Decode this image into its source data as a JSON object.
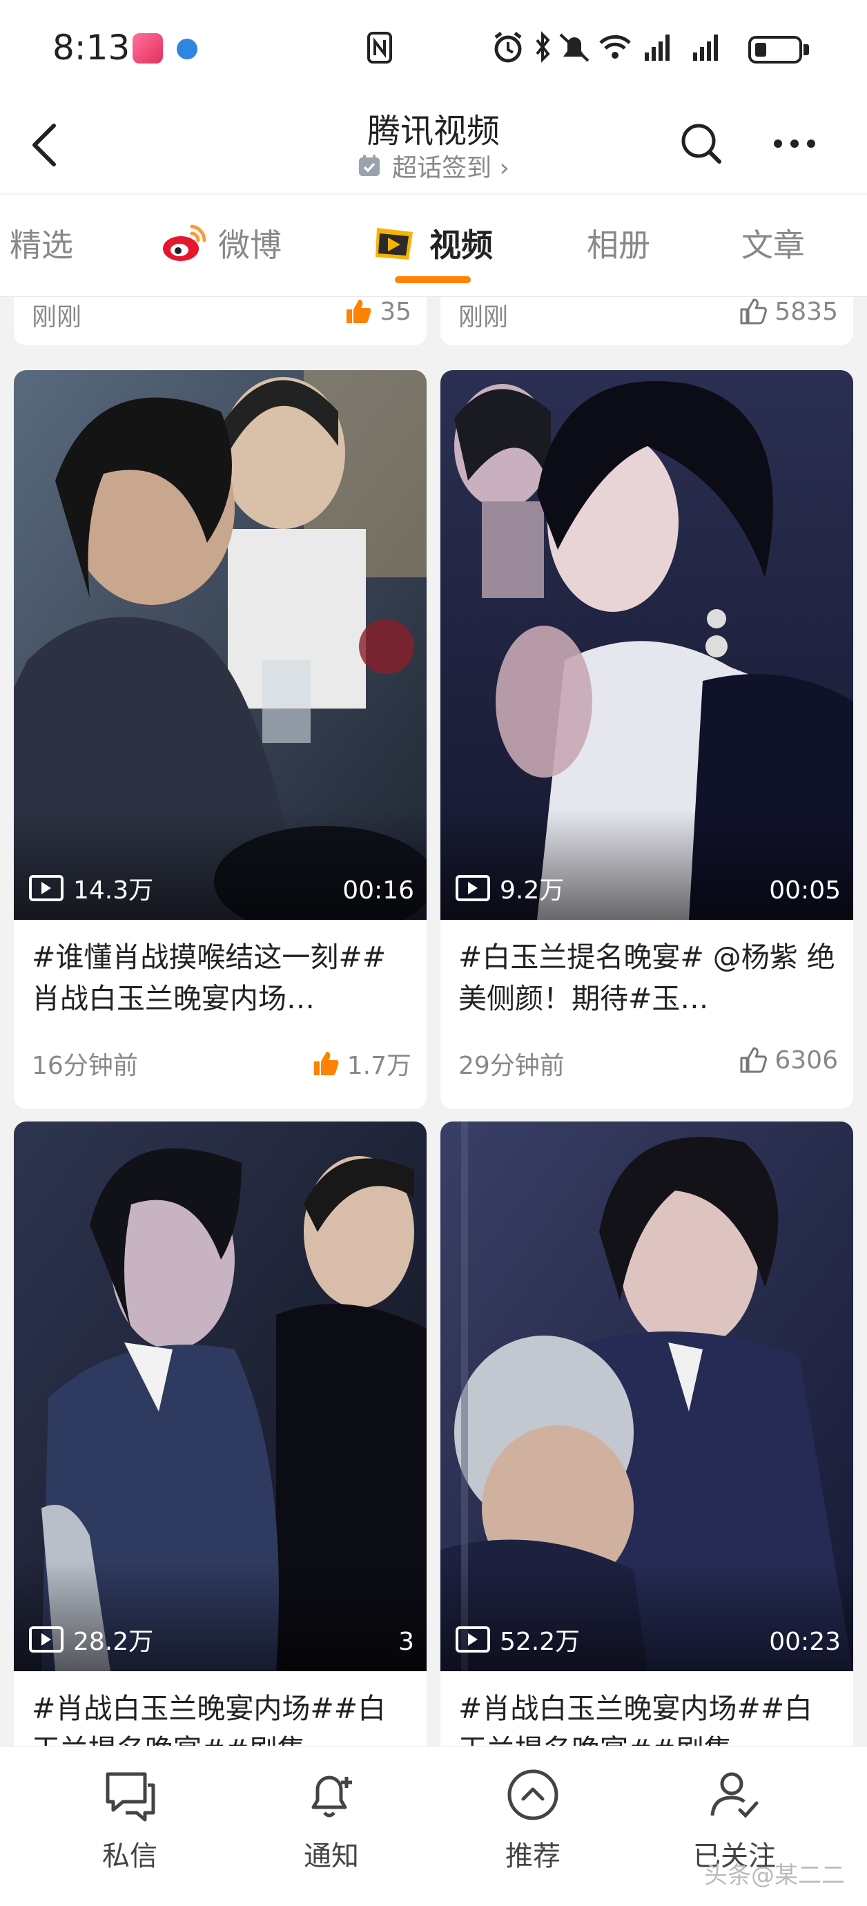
{
  "status_bar": {
    "time": "8:13"
  },
  "header": {
    "title": "腾讯视频",
    "subtitle": "超话签到 ›"
  },
  "tabs": [
    {
      "label": "精选",
      "active": false
    },
    {
      "label": "微博",
      "active": false
    },
    {
      "label": "视频",
      "active": true
    },
    {
      "label": "相册",
      "active": false
    },
    {
      "label": "文章",
      "active": false
    }
  ],
  "top_strip": [
    {
      "time": "刚刚",
      "likes": "35",
      "liked": true
    },
    {
      "time": "刚刚",
      "likes": "5835",
      "liked": false
    }
  ],
  "cards": [
    {
      "views": "14.3万",
      "duration": "00:16",
      "title": "#谁懂肖战摸喉结这一刻##肖战白玉兰晚宴内场…",
      "time": "16分钟前",
      "likes": "1.7万",
      "liked": true
    },
    {
      "views": "9.2万",
      "duration": "00:05",
      "title": "#白玉兰提名晚宴# @杨紫 绝美侧颜！期待#玉…",
      "time": "29分钟前",
      "likes": "6306",
      "liked": false
    },
    {
      "views": "28.2万",
      "duration": "3",
      "title": "#肖战白玉兰晚宴内场##白玉兰提名晚宴##剧集…",
      "time": "",
      "likes": "",
      "liked": false
    },
    {
      "views": "52.2万",
      "duration": "00:23",
      "title": "#肖战白玉兰晚宴内场##白玉兰提名晚宴##剧集…",
      "time": "",
      "likes": "",
      "liked": false
    }
  ],
  "bottom_nav": [
    {
      "label": "私信",
      "icon": "message-icon"
    },
    {
      "label": "通知",
      "icon": "bell-icon"
    },
    {
      "label": "推荐",
      "icon": "recommend-icon"
    },
    {
      "label": "已关注",
      "icon": "user-check-icon"
    }
  ],
  "watermark": "头条@某二二",
  "colors": {
    "accent": "#ff8200",
    "like_active": "#ff8200",
    "text_secondary": "#888888"
  }
}
